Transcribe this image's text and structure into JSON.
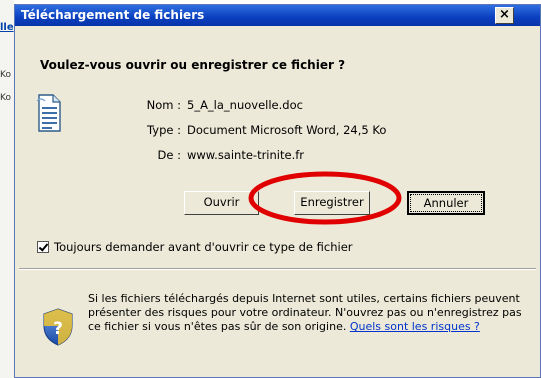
{
  "background": {
    "link_text": "lle",
    "size_texts": [
      "Ko",
      "Ko"
    ]
  },
  "dialog": {
    "title": "Téléchargement de fichiers",
    "close_label": "×",
    "question": "Voulez-vous ouvrir ou enregistrer ce fichier ?",
    "file": {
      "name_label": "Nom :",
      "name_value": "5_A_la_nuovelle.doc",
      "type_label": "Type :",
      "type_value": "Document Microsoft Word, 24,5 Ko",
      "from_label": "De :",
      "from_value": "www.sainte-trinite.fr"
    },
    "buttons": {
      "open": "Ouvrir",
      "save": "Enregistrer",
      "cancel": "Annuler"
    },
    "always_ask": {
      "checked": true,
      "label": "Toujours demander avant d'ouvrir ce type de fichier"
    },
    "info": {
      "text": "Si les fichiers téléchargés depuis Internet sont utiles, certains fichiers peuvent présenter des risques pour votre ordinateur. N'ouvrez pas ou n'enregistrez pas ce fichier si vous n'êtes pas sûr de son origine.",
      "link": "Quels sont les risques ?"
    }
  },
  "annotation": {
    "color": "#e00000"
  },
  "icons": {
    "file": "word-document-icon",
    "shield": "security-shield-icon"
  }
}
